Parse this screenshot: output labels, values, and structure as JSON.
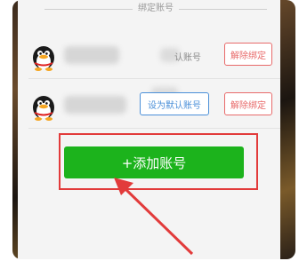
{
  "section": {
    "title": "绑定账号"
  },
  "accounts": [
    {
      "account_label": "认账号",
      "unbind_label": "解除绑定"
    },
    {
      "set_default_label": "设为默认账号",
      "unbind_label": "解除绑定"
    }
  ],
  "add_account": {
    "label": "+添加账号"
  },
  "colors": {
    "primary_green": "#1cb31c",
    "danger_red": "#e86a6a",
    "info_blue": "#4a8fd8",
    "annotation_red": "#e23b3b"
  },
  "icons": {
    "avatar": "qq-penguin-icon"
  }
}
